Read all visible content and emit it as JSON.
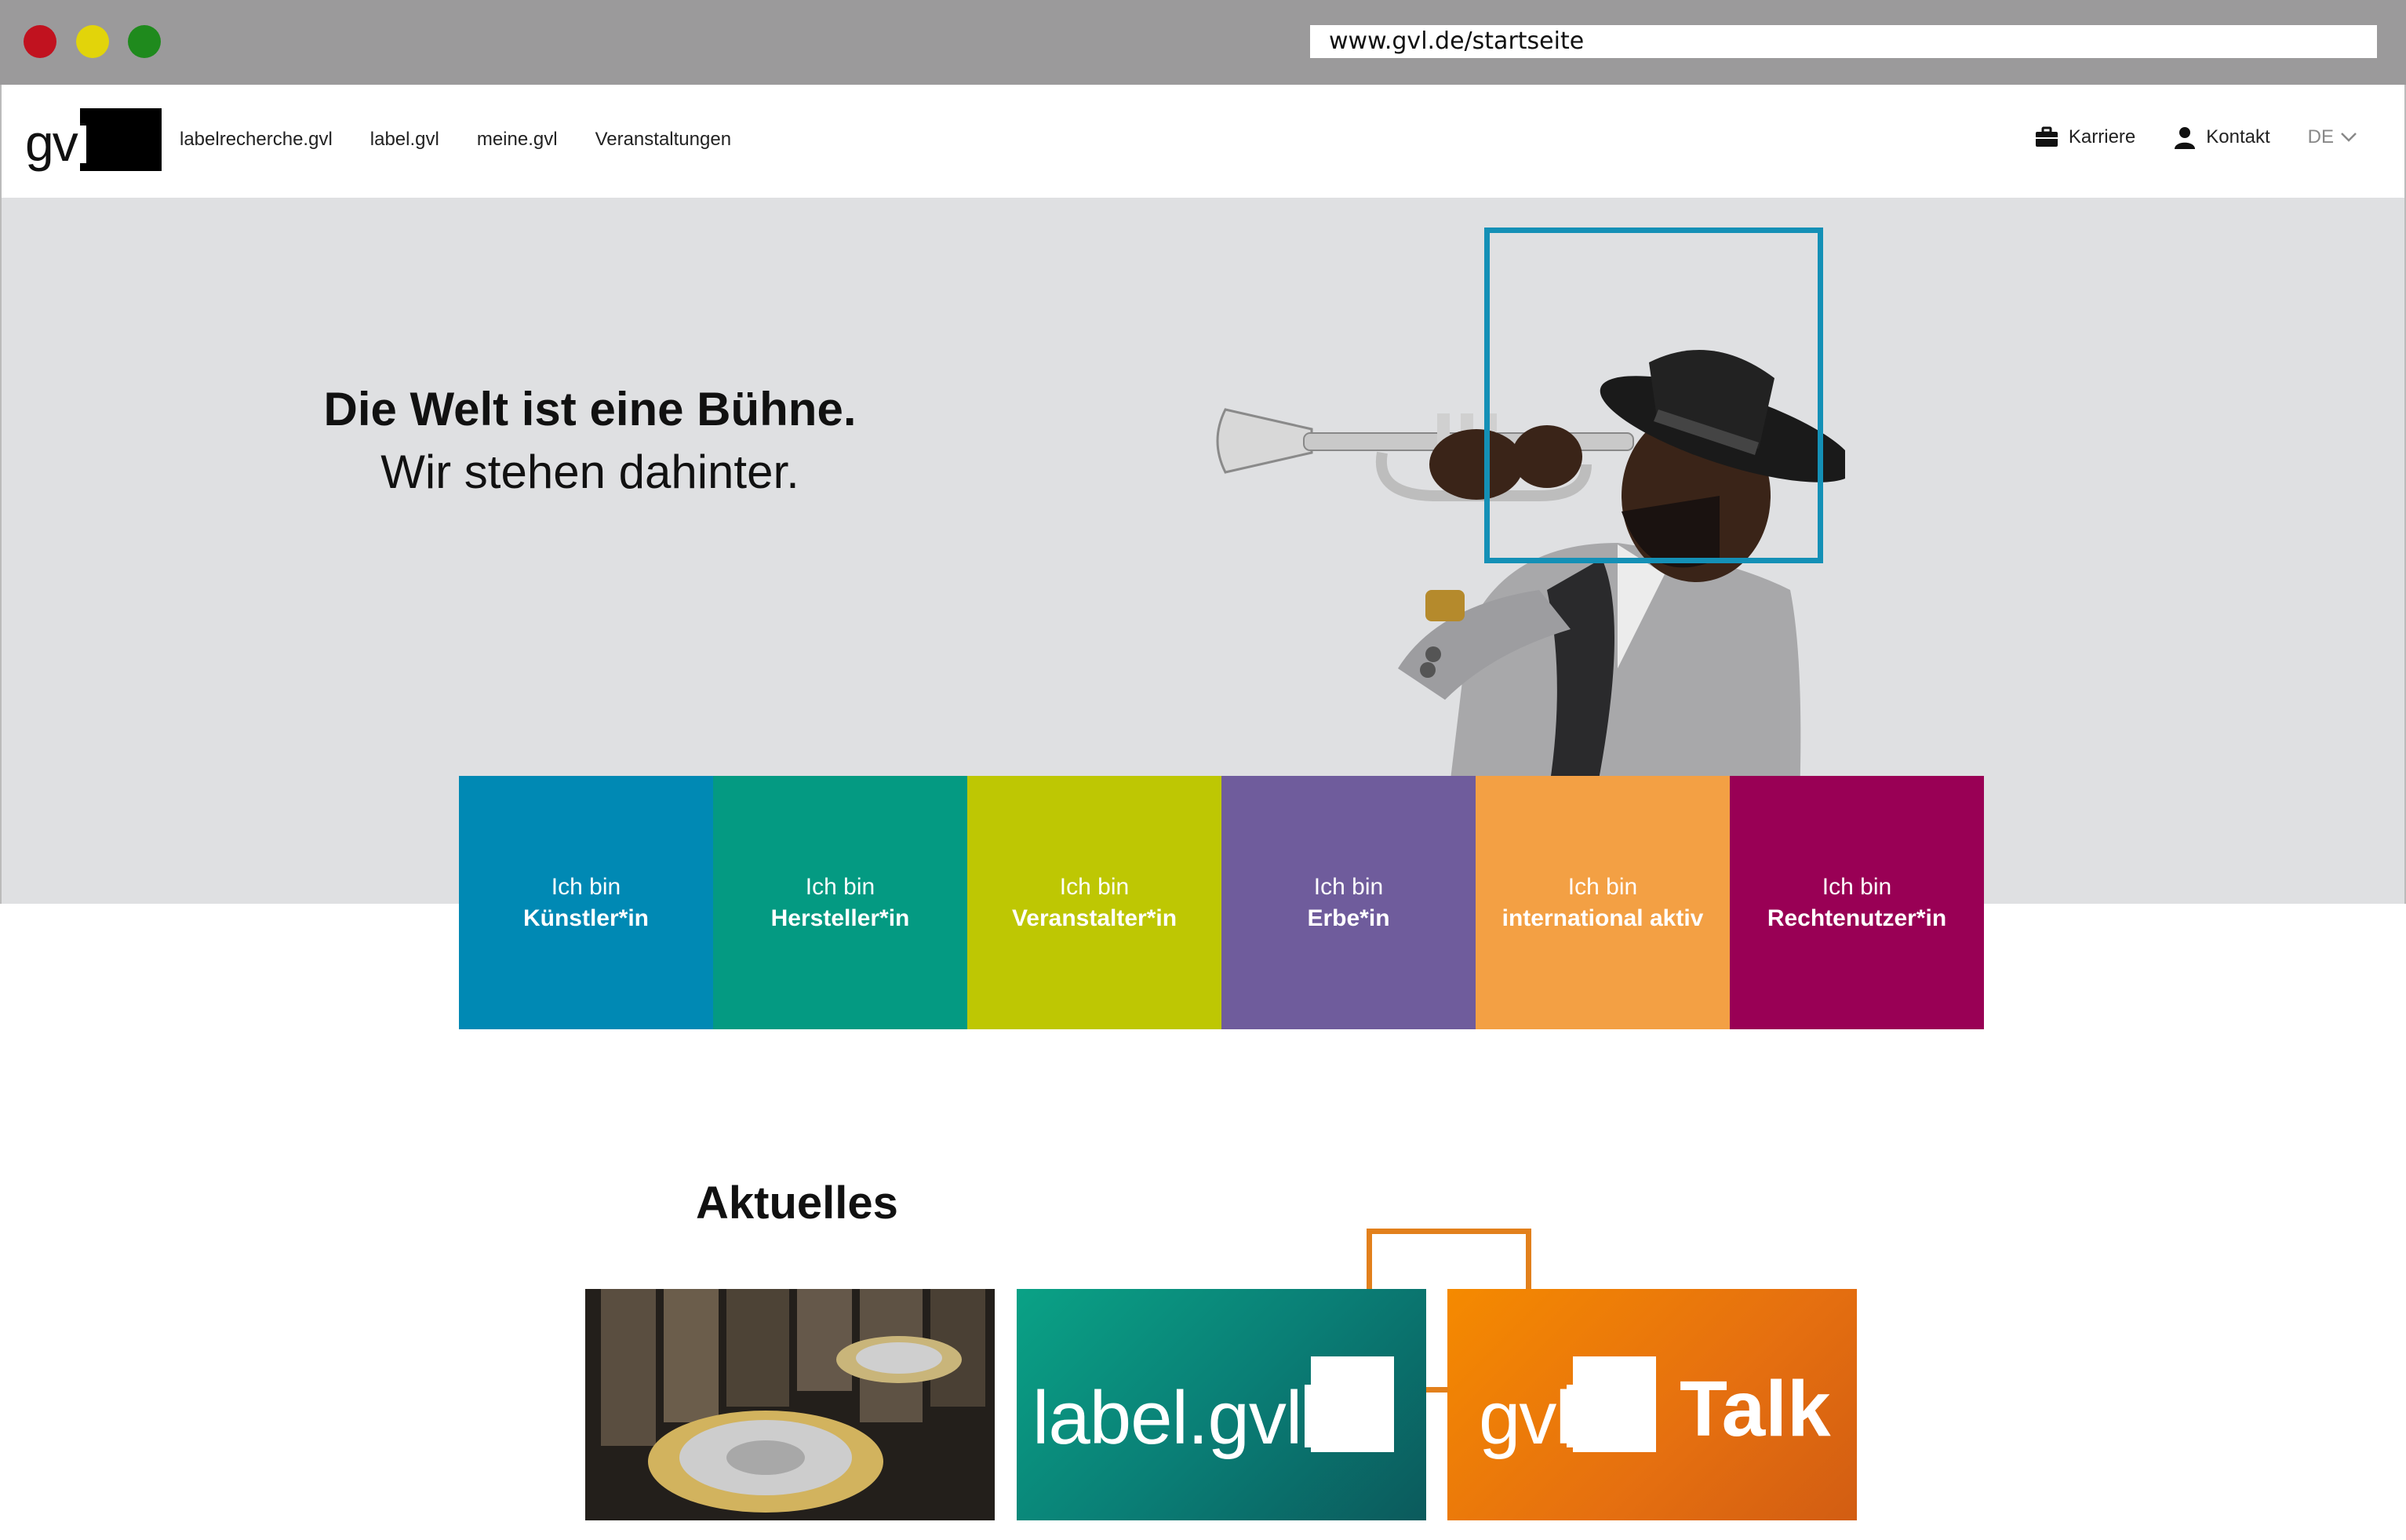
{
  "browser": {
    "url": "www.gvl.de/startseite"
  },
  "header": {
    "logo_text": "gvl",
    "nav": [
      "labelrecherche.gvl",
      "label.gvl",
      "meine.gvl",
      "Veranstaltungen"
    ],
    "util": {
      "career": "Karriere",
      "contact": "Kontakt",
      "lang": "DE"
    }
  },
  "hero": {
    "line1": "Die Welt ist eine Bühne.",
    "line2": "Wir stehen dahinter."
  },
  "tiles": [
    {
      "prefix": "Ich bin",
      "role": "Künstler*in",
      "color": "#0089b4"
    },
    {
      "prefix": "Ich bin",
      "role": "Hersteller*in",
      "color": "#049a82"
    },
    {
      "prefix": "Ich bin",
      "role": "Veranstalter*in",
      "color": "#bec703"
    },
    {
      "prefix": "Ich bin",
      "role": "Erbe*in",
      "color": "#6f5c9c"
    },
    {
      "prefix": "Ich bin",
      "role": "international aktiv",
      "color": "#f3a044"
    },
    {
      "prefix": "Ich bin",
      "role": "Rechtenutzer*in",
      "color": "#990055"
    }
  ],
  "news": {
    "title": "Aktuelles",
    "card2_text": "label.gvl",
    "card3_logo": "gvl",
    "card3_text": "Talk"
  }
}
